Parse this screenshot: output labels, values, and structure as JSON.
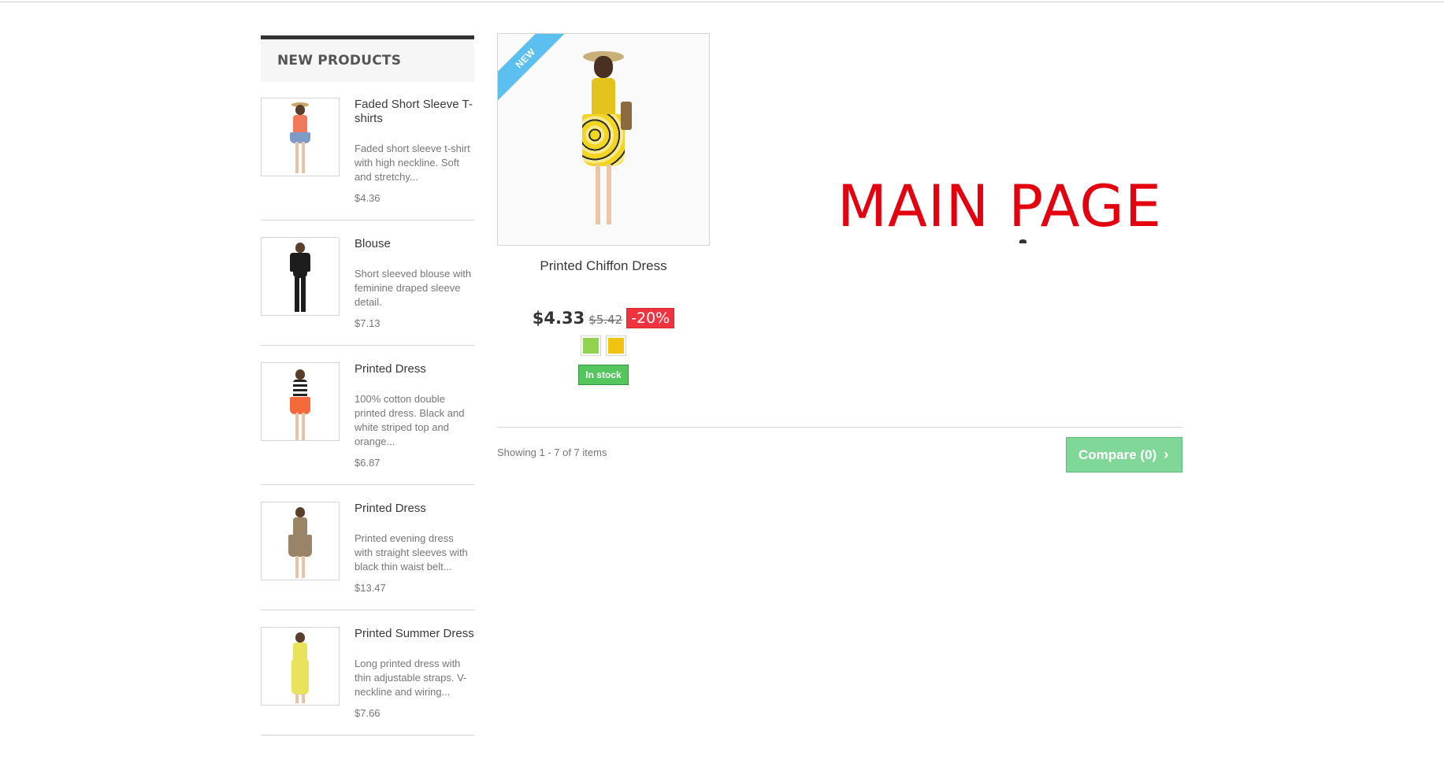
{
  "sidebar": {
    "title": "NEW PRODUCTS",
    "items": [
      {
        "name": "Faded Short Sleeve T-shirts",
        "description": "Faded short sleeve t-shirt with high neckline. Soft and stretchy...",
        "price": "$4.36"
      },
      {
        "name": "Blouse",
        "description": "Short sleeved blouse with feminine draped sleeve detail.",
        "price": "$7.13"
      },
      {
        "name": "Printed Dress",
        "description": "100% cotton double printed dress. Black and white striped top and orange...",
        "price": "$6.87"
      },
      {
        "name": "Printed Dress",
        "description": "Printed evening dress with straight sleeves with black thin waist belt...",
        "price": "$13.47"
      },
      {
        "name": "Printed Summer Dress",
        "description": "Long printed dress with thin adjustable straps. V-neckline and wiring...",
        "price": "$7.66"
      }
    ]
  },
  "product": {
    "badge": "NEW",
    "name": "Printed Chiffon Dress",
    "price": "$4.33",
    "old_price": "$5.42",
    "discount": "-20%",
    "swatches": [
      "#8fd34f",
      "#f0c30f"
    ],
    "stock": "In stock"
  },
  "listing": {
    "showing": "Showing 1 - 7 of 7 items",
    "compare_label": "Compare (0)",
    "compare_icon": "chevron-right-icon"
  },
  "overlay": {
    "label": "MAIN PAGE"
  },
  "colors": {
    "accent_green": "#55c65e",
    "discount_red": "#f13340",
    "ribbon_blue": "#5bc0f0",
    "overlay_red": "#e3000f"
  }
}
